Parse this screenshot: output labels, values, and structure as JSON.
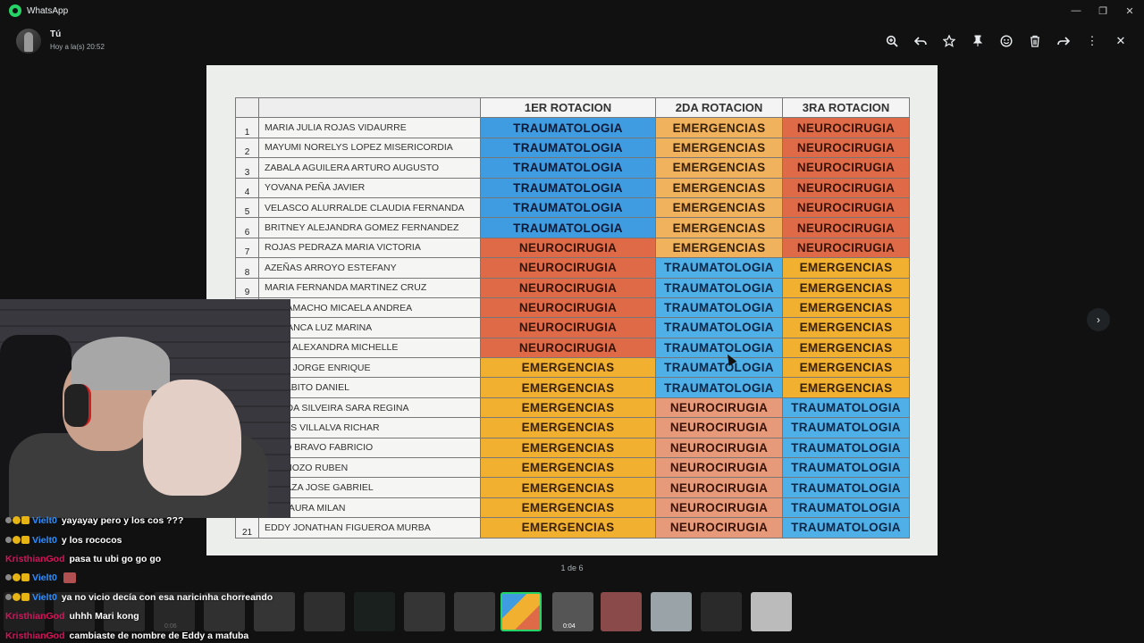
{
  "app": {
    "title": "WhatsApp",
    "icon": "whatsapp-icon"
  },
  "window_controls": [
    "minimize-icon",
    "restore-icon",
    "close-icon"
  ],
  "header": {
    "sender": "Tú",
    "timestamp": "Hoy a la(s) 20:52"
  },
  "toolbar": [
    "zoom-in-icon",
    "reply-icon",
    "star-icon",
    "pin-icon",
    "emoji-icon",
    "delete-icon",
    "forward-icon",
    "more-icon",
    "close-icon"
  ],
  "viewer": {
    "counter": "1 de 6",
    "table": {
      "headers": [
        "1ER ROTACION",
        "2DA ROTACION",
        "3RA ROTACION"
      ],
      "rows": [
        {
          "num": "1",
          "name": "MARIA JULIA ROJAS VIDAURRE",
          "r1": "TRAUMATOLOGIA",
          "r2": "EMERGENCIAS",
          "r3": "NEUROCIRUGIA"
        },
        {
          "num": "2",
          "name": "MAYUMI NORELYS LOPEZ MISERICORDIA",
          "r1": "TRAUMATOLOGIA",
          "r2": "EMERGENCIAS",
          "r3": "NEUROCIRUGIA"
        },
        {
          "num": "3",
          "name": "ZABALA AGUILERA ARTURO AUGUSTO",
          "r1": "TRAUMATOLOGIA",
          "r2": "EMERGENCIAS",
          "r3": "NEUROCIRUGIA"
        },
        {
          "num": "4",
          "name": "YOVANA PEÑA JAVIER",
          "r1": "TRAUMATOLOGIA",
          "r2": "EMERGENCIAS",
          "r3": "NEUROCIRUGIA"
        },
        {
          "num": "5",
          "name": "VELASCO ALURRALDE CLAUDIA FERNANDA",
          "r1": "TRAUMATOLOGIA",
          "r2": "EMERGENCIAS",
          "r3": "NEUROCIRUGIA"
        },
        {
          "num": "6",
          "name": "BRITNEY ALEJANDRA GOMEZ FERNANDEZ",
          "r1": "TRAUMATOLOGIA",
          "r2": "EMERGENCIAS",
          "r3": "NEUROCIRUGIA"
        },
        {
          "num": "7",
          "name": "ROJAS PEDRAZA MARIA VICTORIA",
          "r1": "NEUROCIRUGIA",
          "r2": "EMERGENCIAS",
          "r3": "NEUROCIRUGIA"
        },
        {
          "num": "8",
          "name": "AZEÑAS ARROYO ESTEFANY",
          "r1": "NEUROCIRUGIA",
          "r2": "TRAUMATOLOGIA",
          "r3": "EMERGENCIAS"
        },
        {
          "num": "9",
          "name": "MARIA FERNANDA MARTINEZ CRUZ",
          "r1": "NEUROCIRUGIA",
          "r2": "TRAUMATOLOGIA",
          "r3": "EMERGENCIAS"
        },
        {
          "num": "",
          "name": "CA CAMACHO MICAELA ANDREA",
          "r1": "NEUROCIRUGIA",
          "r2": "TRAUMATOLOGIA",
          "r3": "EMERGENCIAS"
        },
        {
          "num": "",
          "name": "S HUANCA LUZ MARINA",
          "r1": "NEUROCIRUGIA",
          "r2": "TRAUMATOLOGIA",
          "r3": "EMERGENCIAS"
        },
        {
          "num": "",
          "name": "AZOS ALEXANDRA MICHELLE",
          "r1": "NEUROCIRUGIA",
          "r2": "TRAUMATOLOGIA",
          "r3": "EMERGENCIAS"
        },
        {
          "num": "",
          "name": "VEGA JORGE ENRIQUE",
          "r1": "EMERGENCIAS",
          "r2": "TRAUMATOLOGIA",
          "r3": "EMERGENCIAS"
        },
        {
          "num": "",
          "name": "GARABITO DANIEL",
          "r1": "EMERGENCIAS",
          "r2": "TRAUMATOLOGIA",
          "r3": "EMERGENCIAS"
        },
        {
          "num": "",
          "name": "OSA DA SILVEIRA SARA REGINA",
          "r1": "EMERGENCIAS",
          "r2": "NEUROCIRUGIA",
          "r3": "TRAUMATOLOGIA"
        },
        {
          "num": "",
          "name": "TEROS VILLALVA RICHAR",
          "r1": "EMERGENCIAS",
          "r2": "NEUROCIRUGIA",
          "r3": "TRAUMATOLOGIA"
        },
        {
          "num": "",
          "name": "RANO BRAVO FABRICIO",
          "r1": "EMERGENCIAS",
          "r2": "NEUROCIRUGIA",
          "r3": "TRAUMATOLOGIA"
        },
        {
          "num": "",
          "name": "S PANOZO RUBEN",
          "r1": "EMERGENCIAS",
          "r2": "NEUROCIRUGIA",
          "r3": "TRAUMATOLOGIA"
        },
        {
          "num": "",
          "name": "N APAZA JOSE GABRIEL",
          "r1": "EMERGENCIAS",
          "r2": "NEUROCIRUGIA",
          "r3": "TRAUMATOLOGIA"
        },
        {
          "num": "",
          "name": "LIA MAURA MILAN",
          "r1": "EMERGENCIAS",
          "r2": "NEUROCIRUGIA",
          "r3": "TRAUMATOLOGIA"
        },
        {
          "num": "21",
          "name": "EDDY JONATHAN FIGUEROA MURBA",
          "r1": "EMERGENCIAS",
          "r2": "NEUROCIRUGIA",
          "r3": "TRAUMATOLOGIA"
        }
      ]
    }
  },
  "thumbnails": [
    {
      "kind": "image"
    },
    {
      "kind": "image"
    },
    {
      "kind": "image"
    },
    {
      "kind": "video",
      "duration": "0:06"
    },
    {
      "kind": "image"
    },
    {
      "kind": "image"
    },
    {
      "kind": "image"
    },
    {
      "kind": "image"
    },
    {
      "kind": "image"
    },
    {
      "kind": "image"
    },
    {
      "kind": "image",
      "active": true
    },
    {
      "kind": "video",
      "duration": "0:04"
    },
    {
      "kind": "image"
    },
    {
      "kind": "image"
    },
    {
      "kind": "image"
    },
    {
      "kind": "image"
    }
  ],
  "stream_chat": [
    {
      "user": "Vielt0",
      "color": "blue",
      "text": "yayayay pero y los cos ???"
    },
    {
      "user": "Vielt0",
      "color": "blue",
      "text": "y los rococos"
    },
    {
      "user": "KristhianGod",
      "color": "red",
      "text": "pasa tu ubi go go go"
    },
    {
      "user": "Vielt0",
      "color": "blue",
      "text": ""
    },
    {
      "user": "Vielt0",
      "color": "blue",
      "text": "ya no vicio decía con esa naricinha chorreando"
    },
    {
      "user": "KristhianGod",
      "color": "red",
      "text": "uhhh Mari kong"
    },
    {
      "user": "KristhianGod",
      "color": "red",
      "text": "cambiaste de nombre de Eddy a mafuba"
    }
  ],
  "colors": {
    "traumatologia": "#3f9ce0",
    "emergencias": "#f2b030",
    "neurocirugia": "#df6a48",
    "accent": "#25d366"
  }
}
